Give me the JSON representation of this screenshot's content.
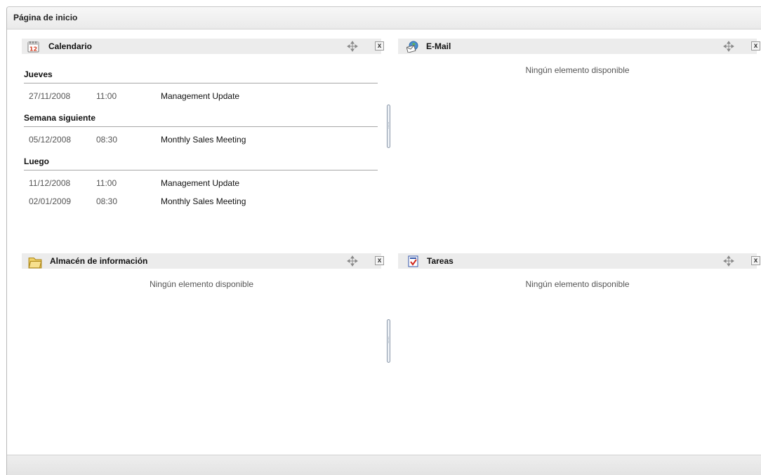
{
  "window": {
    "title": "Página de inicio"
  },
  "calendar": {
    "title": "Calendario",
    "icon": "calendar-12-icon",
    "groups": [
      {
        "label": "Jueves",
        "events": [
          {
            "date": "27/11/2008",
            "time": "11:00",
            "subject": "Management Update"
          }
        ]
      },
      {
        "label": "Semana siguiente",
        "events": [
          {
            "date": "05/12/2008",
            "time": "08:30",
            "subject": "Monthly Sales Meeting"
          }
        ]
      },
      {
        "label": "Luego",
        "events": [
          {
            "date": "11/12/2008",
            "time": "11:00",
            "subject": "Management Update"
          },
          {
            "date": "02/01/2009",
            "time": "08:30",
            "subject": "Monthly Sales Meeting"
          }
        ]
      }
    ]
  },
  "email": {
    "title": "E-Mail",
    "icon": "email-envelope-icon",
    "empty": "Ningún elemento disponible"
  },
  "storage": {
    "title": "Almacén de información",
    "icon": "folder-icon",
    "empty": "Ningún elemento disponible"
  },
  "tasks": {
    "title": "Tareas",
    "icon": "task-checklist-icon",
    "empty": "Ningún elemento disponible"
  },
  "controls": {
    "close_label": "x"
  }
}
